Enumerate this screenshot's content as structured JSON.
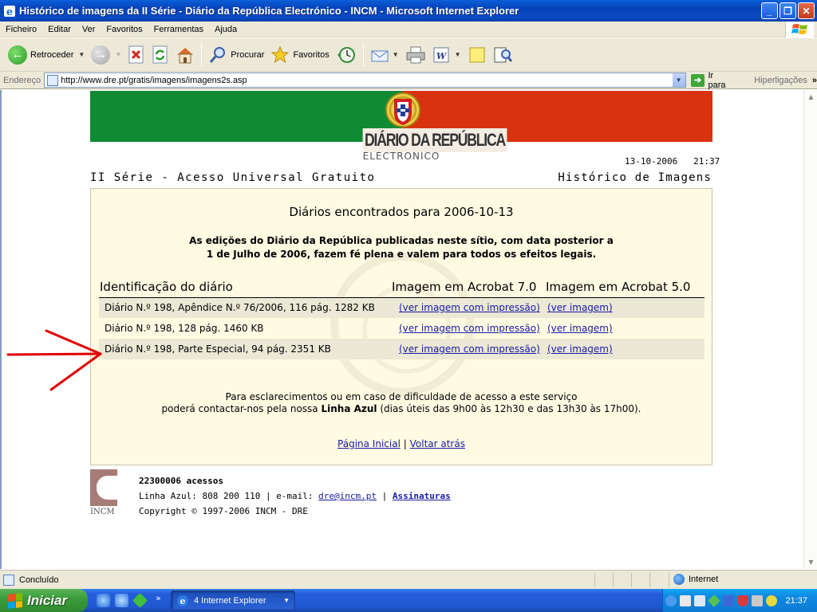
{
  "window": {
    "title": "Histórico de imagens da II Série - Diário da República Electrónico - INCM - Microsoft Internet Explorer"
  },
  "menu": [
    "Ficheiro",
    "Editar",
    "Ver",
    "Favoritos",
    "Ferramentas",
    "Ajuda"
  ],
  "toolbar": {
    "back_label": "Retroceder",
    "search_label": "Procurar",
    "favorites_label": "Favoritos"
  },
  "address": {
    "label": "Endereço",
    "url": "http://www.dre.pt/gratis/imagens/imagens2s.asp",
    "go_label": "Ir para",
    "links_label": "Hiperligações"
  },
  "page": {
    "logo_main": "DIÁRIO DA REPÚBLICA",
    "logo_sub": "ELECTRÓNICO",
    "date": "13-10-2006",
    "time": "21:37",
    "series_title": "II Série - Acesso Universal Gratuito",
    "history_title": "Histórico de Imagens",
    "found_heading": "Diários encontrados para 2006-10-13",
    "notice_line1": "As edições do Diário da República publicadas neste sítio, com data posterior a",
    "notice_line2": "1 de Julho de 2006, fazem fé plena e valem para todos os efeitos legais.",
    "columns": [
      "Identificação do diário",
      "Imagem em Acrobat 7.0",
      "Imagem em Acrobat 5.0"
    ],
    "rows": [
      {
        "id": "Diário N.º 198, Apêndice N.º 76/2006, 116 pág. 1282 KB",
        "acrobat7": "(ver imagem com impressão)",
        "acrobat5": "(ver imagem)"
      },
      {
        "id": "Diário N.º 198, 128 pág. 1460 KB",
        "acrobat7": "(ver imagem com impressão)",
        "acrobat5": "(ver imagem)"
      },
      {
        "id": "Diário N.º 198, Parte Especial, 94 pág. 2351 KB",
        "acrobat7": "(ver imagem com impressão)",
        "acrobat5": "(ver imagem)"
      }
    ],
    "contact_line1": "Para esclarecimentos ou em caso de dificuldade de acesso a este serviço",
    "contact_line2_pre": "poderá contactar-nos pela nossa",
    "contact_line2_bold": "Linha Azul",
    "contact_line2_post": "(dias úteis das 9h00 às 12h30 e das 13h30 às 17h00).",
    "home_link": "Página Inicial",
    "link_separator": "|",
    "back_link": "Voltar atrás"
  },
  "footer": {
    "logo_text": "INCM",
    "access_count": "22300006 acessos",
    "phone_text": "Linha Azul: 808 200 110 | e-mail:",
    "email": "dre@incm.pt",
    "separator": "|",
    "subscriptions": "Assinaturas",
    "copyright": "Copyright © 1997-2006 INCM - DRE"
  },
  "status": {
    "text": "Concluído",
    "zone": "Internet"
  },
  "taskbar": {
    "start_label": "Iniciar",
    "task_label": "4 Internet Explorer",
    "clock": "21:37"
  },
  "colors": {
    "flag_green": "#108a33",
    "flag_red": "#d6330e",
    "panel_bg": "#fffbe3",
    "link": "#1a1aa6",
    "arrow": "#e00000"
  }
}
